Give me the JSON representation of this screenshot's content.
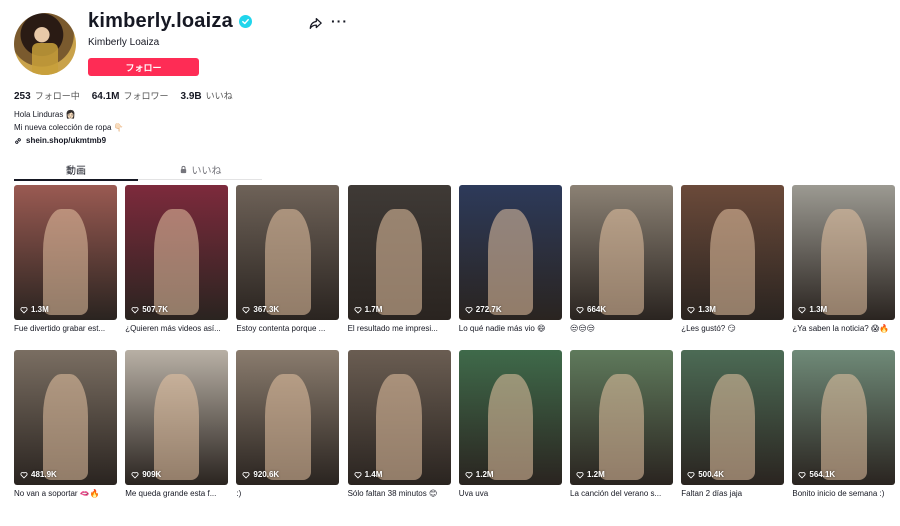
{
  "profile": {
    "username": "kimberly.loaiza",
    "nickname": "Kimberly Loaiza",
    "follow_label": "フォロー",
    "stats": {
      "following_count": "253",
      "following_label": "フォロー中",
      "followers_count": "64.1M",
      "followers_label": "フォロワー",
      "likes_count": "3.9B",
      "likes_label": "いいね"
    },
    "bio_line1": "Hola Linduras 👩🏻",
    "bio_line2": "Mi nueva colección de ropa 👇🏻",
    "link": "shein.shop/ukmtmb9"
  },
  "tabs": [
    {
      "label": "動画"
    },
    {
      "label": "いいね"
    }
  ],
  "colors": {
    "accent": "#fe2c55",
    "verified": "#20d5ec"
  },
  "videos": [
    {
      "views": "1.3M",
      "caption": "Fue divertido grabar est...",
      "bg": "#9a5a52"
    },
    {
      "views": "507.7K",
      "caption": "¿Quieren más videos así...",
      "bg": "#7d2a3c"
    },
    {
      "views": "367.3K",
      "caption": "Estoy contenta porque ...",
      "bg": "#6e6258"
    },
    {
      "views": "1.7M",
      "caption": "El resultado me impresi...",
      "bg": "#3f3a36"
    },
    {
      "views": "272.7K",
      "caption": "Lo qué nadie más vio 😄",
      "bg": "#2d3a5a"
    },
    {
      "views": "664K",
      "caption": "😒😒😒",
      "bg": "#8b8174"
    },
    {
      "views": "1.3M",
      "caption": "¿Les gustó? 😏",
      "bg": "#6b4a3a"
    },
    {
      "views": "1.3M",
      "caption": "¿Ya saben la noticia? 😱🔥",
      "bg": "#9c9a92"
    },
    {
      "views": "481.9K",
      "caption": "No van a soportar 🫦🔥",
      "bg": "#7a6e62"
    },
    {
      "views": "909K",
      "caption": "Me queda grande esta f...",
      "bg": "#b8b0a5"
    },
    {
      "views": "920.6K",
      "caption": ":)",
      "bg": "#8a7c6e"
    },
    {
      "views": "1.4M",
      "caption": "Sólo faltan 38 minutos 😊",
      "bg": "#6a5d52"
    },
    {
      "views": "1.2M",
      "caption": "Uva uva",
      "bg": "#3f6a4a"
    },
    {
      "views": "1.2M",
      "caption": "La canción del verano s...",
      "bg": "#5f7a5c"
    },
    {
      "views": "500.4K",
      "caption": "Faltan 2 días jaja",
      "bg": "#4c6b55"
    },
    {
      "views": "564.1K",
      "caption": "Bonito inicio de semana :)",
      "bg": "#6f8a78"
    }
  ]
}
